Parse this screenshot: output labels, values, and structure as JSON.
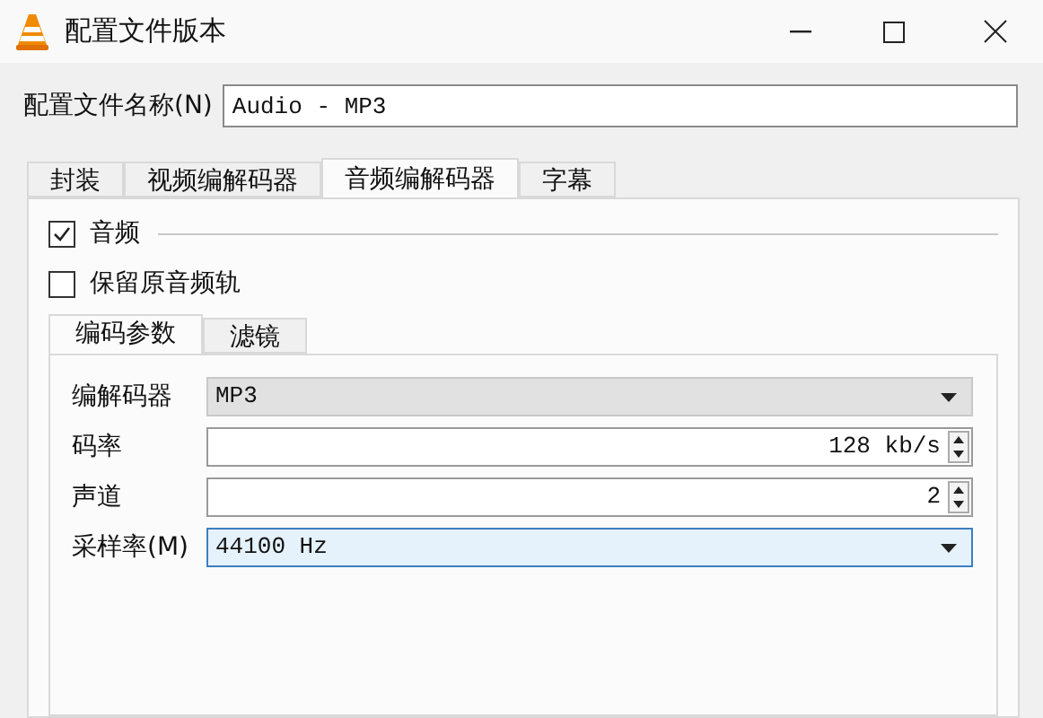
{
  "window": {
    "title": "配置文件版本"
  },
  "profile_name": {
    "label": "配置文件名称(N)",
    "value": "Audio - MP3"
  },
  "tabs": [
    {
      "label": "封装",
      "selected": false
    },
    {
      "label": "视频编解码器",
      "selected": false
    },
    {
      "label": "音频编解码器",
      "selected": true
    },
    {
      "label": "字幕",
      "selected": false
    }
  ],
  "audio": {
    "label": "音频",
    "checked": true
  },
  "keep_original": {
    "label": "保留原音频轨",
    "checked": false
  },
  "sub_tabs": [
    {
      "label": "编码参数",
      "selected": true
    },
    {
      "label": "滤镜",
      "selected": false
    }
  ],
  "fields": [
    {
      "kind": "dropdown",
      "label": "编解码器",
      "value": "MP3",
      "focused": false
    },
    {
      "kind": "spin",
      "label": "码率",
      "value": "128 kb/s",
      "focused": false
    },
    {
      "kind": "spin",
      "label": "声道",
      "value": "2",
      "focused": false
    },
    {
      "kind": "dropdown",
      "label": "采样率(M)",
      "value": "44100 Hz",
      "focused": true
    }
  ]
}
